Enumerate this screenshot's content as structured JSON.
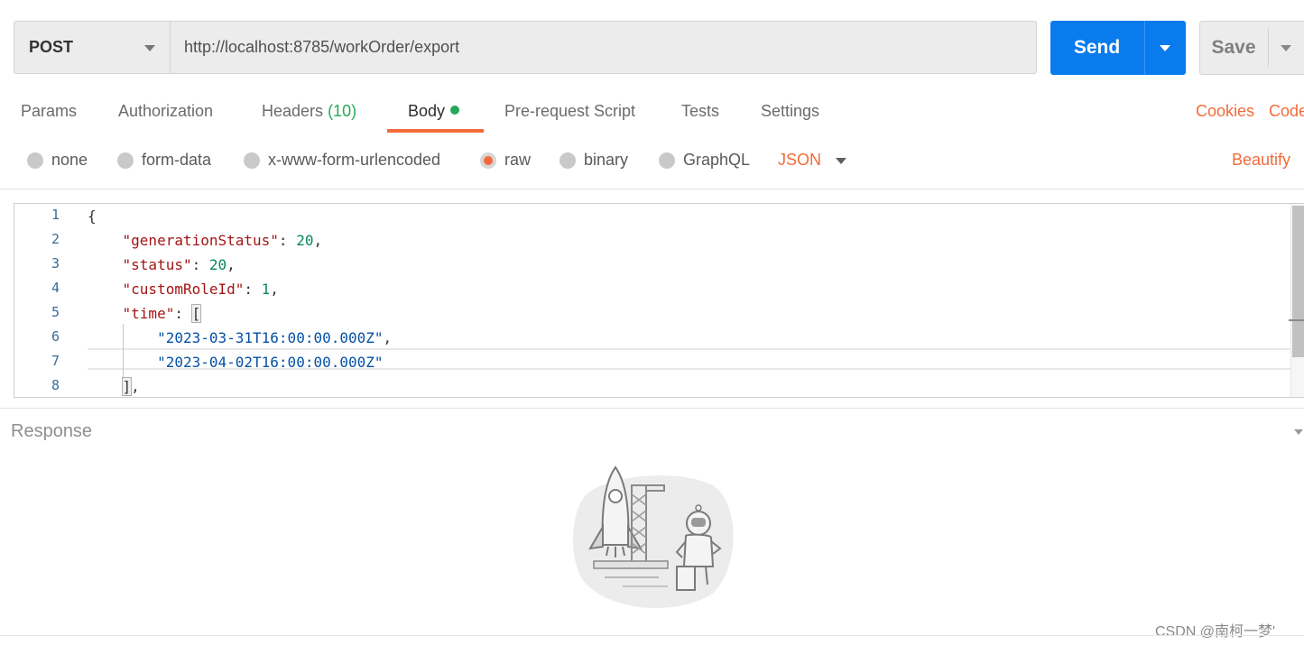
{
  "request": {
    "method": "POST",
    "url": "http://localhost:8785/workOrder/export",
    "send_label": "Send",
    "save_label": "Save"
  },
  "tabs": [
    {
      "label": "Params"
    },
    {
      "label": "Authorization"
    },
    {
      "label": "Headers",
      "count": "(10)"
    },
    {
      "label": "Body",
      "active": true
    },
    {
      "label": "Pre-request Script"
    },
    {
      "label": "Tests"
    },
    {
      "label": "Settings"
    }
  ],
  "links": {
    "cookies": "Cookies",
    "code": "Code",
    "beautify": "Beautify"
  },
  "body_types": [
    "none",
    "form-data",
    "x-www-form-urlencoded",
    "raw",
    "binary",
    "GraphQL"
  ],
  "body_type_selected": "raw",
  "body_language": "JSON",
  "editor": {
    "line_numbers": [
      "1",
      "2",
      "3",
      "4",
      "5",
      "6",
      "7",
      "8"
    ],
    "lines": [
      "{",
      "    \"generationStatus\": 20,",
      "    \"status\": 20,",
      "    \"customRoleId\": 1,",
      "    \"time\": [",
      "        \"2023-03-31T16:00:00.000Z\",",
      "        \"2023-04-02T16:00:00.000Z\"",
      "    ],"
    ],
    "tokens": {
      "l2_key": "\"generationStatus\"",
      "l2_val": "20",
      "l3_key": "\"status\"",
      "l3_val": "20",
      "l4_key": "\"customRoleId\"",
      "l4_val": "1",
      "l5_key": "\"time\"",
      "l6_val": "\"2023-03-31T16:00:00.000Z\"",
      "l7_val": "\"2023-04-02T16:00:00.000Z\""
    }
  },
  "response": {
    "label": "Response"
  },
  "watermark": "CSDN @南柯一梦'",
  "colors": {
    "accent": "#f26b3a",
    "send": "#097bed",
    "active_dot": "#26a85a",
    "json_key": "#a31515",
    "json_number": "#098658",
    "json_string": "#0451a5"
  },
  "icons": [
    "chevron-down-icon",
    "rocket-astronaut-illustration"
  ]
}
